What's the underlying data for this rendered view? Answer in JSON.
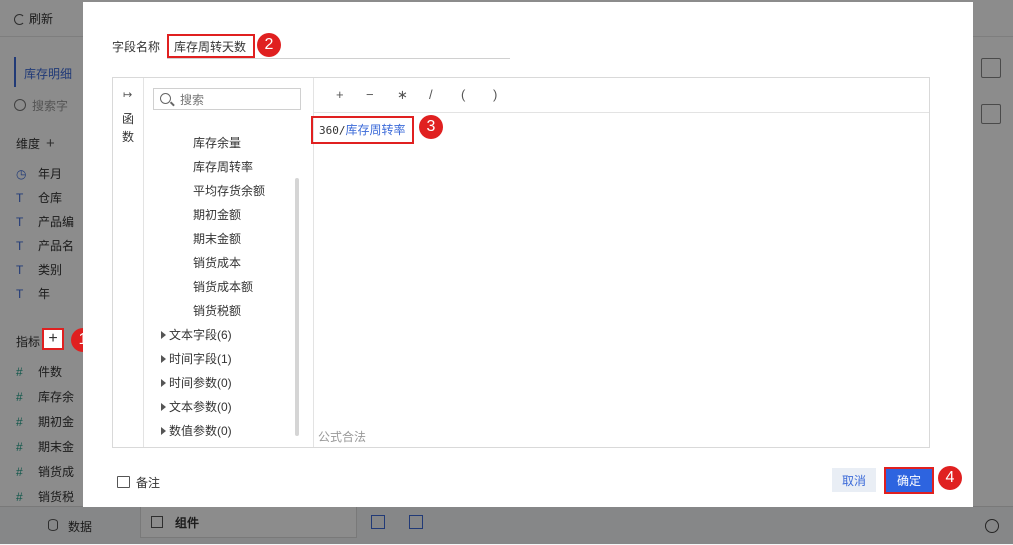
{
  "background": {
    "refresh_label": "刷新",
    "dataset_label": "库存明细",
    "search_placeholder": "搜索字",
    "dimension_title": "维度",
    "dimensions": [
      {
        "icon": "calendar-icon",
        "label": "年月"
      },
      {
        "icon": "text-field-icon",
        "label": "仓库"
      },
      {
        "icon": "text-field-icon",
        "label": "产品编"
      },
      {
        "icon": "text-field-icon",
        "label": "产品名"
      },
      {
        "icon": "text-field-icon",
        "label": "类别"
      },
      {
        "icon": "text-field-icon",
        "label": "年"
      }
    ],
    "measure_title": "指标",
    "measures": [
      {
        "icon": "number-field-icon",
        "label": "件数"
      },
      {
        "icon": "number-field-icon",
        "label": "库存余"
      },
      {
        "icon": "number-field-icon",
        "label": "期初金"
      },
      {
        "icon": "number-field-icon",
        "label": "期末金"
      },
      {
        "icon": "number-field-icon",
        "label": "销货成"
      },
      {
        "icon": "number-field-icon",
        "label": "销货税"
      }
    ],
    "tab_data": "数据",
    "tab_component": "组件"
  },
  "dialog": {
    "field_name_label": "字段名称",
    "field_name_value": "库存周转天数",
    "fn_rail_label": "函数",
    "fn_search_placeholder": "搜索",
    "fn_items": [
      "库存余量",
      "库存周转率",
      "平均存货余额",
      "期初金额",
      "期末金额",
      "销货成本",
      "销货成本额",
      "销货税额"
    ],
    "fn_groups": [
      "文本字段(6)",
      "时间字段(1)",
      "时间参数(0)",
      "文本参数(0)",
      "数值参数(0)"
    ],
    "operators": [
      "+",
      "−",
      "∗",
      "/",
      "(",
      ")"
    ],
    "formula_number": "360/",
    "formula_field": "库存周转率",
    "formula_status": "公式合法",
    "note_label": "备注",
    "cancel_label": "取消",
    "ok_label": "确定"
  },
  "annotations": [
    "1",
    "2",
    "3",
    "4"
  ],
  "colors": {
    "accent": "#2d64e0",
    "annotation": "#e02020",
    "field_link": "#3c6bd9"
  }
}
